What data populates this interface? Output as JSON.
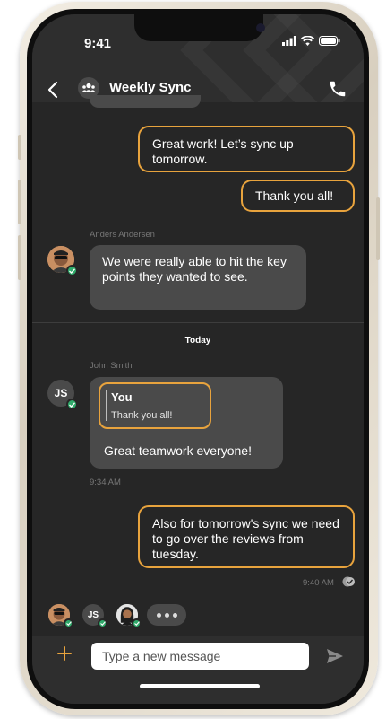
{
  "status_bar": {
    "time": "9:41"
  },
  "header": {
    "title": "Weekly Sync"
  },
  "messages": {
    "out1": "Great work! Let’s sync up tomorrow.",
    "out2": "Thank you all!",
    "anders_sender": "Anders Andersen",
    "anders_text": "We were really able to hit the key points they wanted to see.",
    "day_separator": "Today",
    "john_sender": "John Smith",
    "john_initials": "JS",
    "quote_author": "You",
    "quote_text": "Thank you all!",
    "john_text": "Great teamwork everyone!",
    "john_time": "9:34 AM",
    "out3": "Also for tomorrow's sync we need to go over the reviews from tuesday.",
    "out3_time": "9:40 AM"
  },
  "participants": {
    "js_initials": "JS"
  },
  "composer": {
    "placeholder": "Type a new message"
  },
  "colors": {
    "accent": "#e8a33d",
    "verified": "#2faa6a",
    "background": "#262626",
    "bubble_in": "#4a4a4a"
  }
}
